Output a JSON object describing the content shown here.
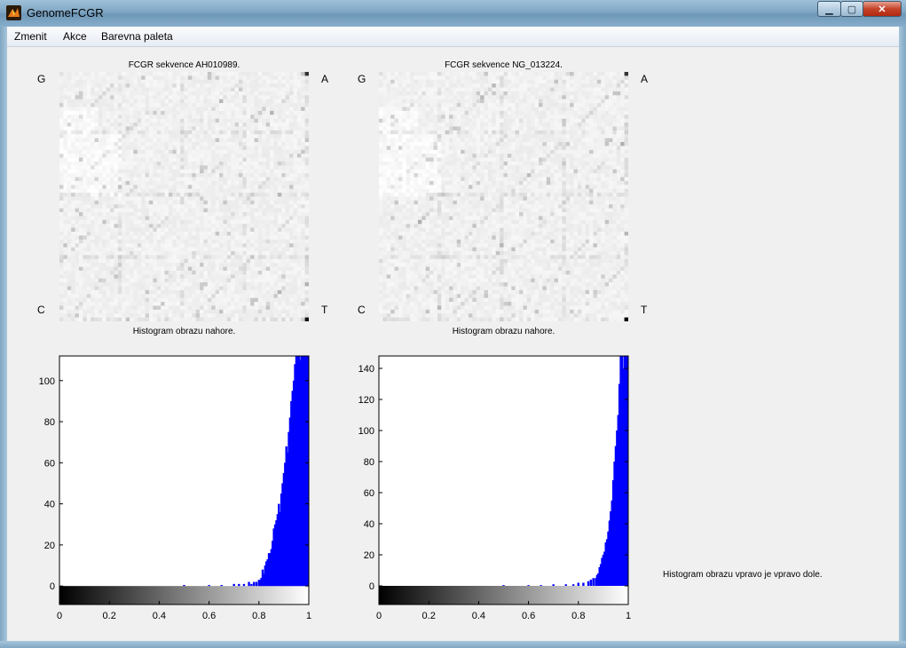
{
  "window": {
    "title": "GenomeFCGR",
    "min_glyph": "▁",
    "max_glyph": "▢",
    "close_glyph": "✕"
  },
  "menu": {
    "items": [
      "Zmenit",
      "Akce",
      "Barevna paleta"
    ]
  },
  "panels": [
    {
      "fcgr_title": "FCGR sekvence AH010989.",
      "corners": {
        "top_left": "G",
        "top_right": "A",
        "bottom_left": "C",
        "bottom_right": "T"
      }
    },
    {
      "fcgr_title": "FCGR sekvence NG_013224.",
      "corners": {
        "top_left": "G",
        "top_right": "A",
        "bottom_left": "C",
        "bottom_right": "T"
      }
    }
  ],
  "note": "Histogram obrazu vpravo je vpravo dole.",
  "colors": {
    "bar": "#0000ff",
    "colorbar_from": "#000000",
    "colorbar_to": "#ffffff"
  },
  "chart_data": [
    {
      "type": "bar",
      "title": "Histogram obrazu nahore.",
      "xlabel": "",
      "ylabel": "",
      "xlim": [
        0,
        1
      ],
      "ylim": [
        -9,
        112
      ],
      "xticks": [
        "0",
        "0.2",
        "0.4",
        "0.6",
        "0.8",
        "1"
      ],
      "yticks": [
        "0",
        "20",
        "40",
        "60",
        "80",
        "100"
      ],
      "grid": false,
      "x": [
        0.5,
        0.6,
        0.65,
        0.7,
        0.72,
        0.74,
        0.76,
        0.77,
        0.78,
        0.79,
        0.8,
        0.805,
        0.81,
        0.815,
        0.82,
        0.825,
        0.83,
        0.835,
        0.84,
        0.845,
        0.85,
        0.855,
        0.86,
        0.865,
        0.87,
        0.875,
        0.88,
        0.885,
        0.89,
        0.895,
        0.9,
        0.905,
        0.91,
        0.915,
        0.92,
        0.925,
        0.93,
        0.935,
        0.94,
        0.945,
        0.95,
        0.955,
        0.96,
        0.965,
        0.97,
        0.975,
        0.98,
        0.985,
        0.99,
        0.995
      ],
      "values": [
        0.5,
        0.5,
        0.5,
        1,
        1,
        1,
        2,
        1,
        2,
        2,
        3,
        3,
        4,
        8,
        6,
        10,
        12,
        13,
        16,
        16,
        18,
        22,
        28,
        30,
        32,
        35,
        40,
        36,
        45,
        50,
        55,
        60,
        68,
        65,
        75,
        82,
        90,
        95,
        100,
        108,
        112,
        112,
        112,
        110,
        112,
        112,
        112,
        112,
        112,
        112
      ]
    },
    {
      "type": "bar",
      "title": "Histogram obrazu nahore.",
      "xlabel": "",
      "ylabel": "",
      "xlim": [
        0,
        1
      ],
      "ylim": [
        -12,
        148
      ],
      "xticks": [
        "0",
        "0.2",
        "0.4",
        "0.6",
        "0.8",
        "1"
      ],
      "yticks": [
        "0",
        "20",
        "40",
        "60",
        "80",
        "100",
        "120",
        "140"
      ],
      "grid": false,
      "x": [
        0.5,
        0.6,
        0.65,
        0.7,
        0.75,
        0.78,
        0.8,
        0.82,
        0.84,
        0.85,
        0.86,
        0.87,
        0.875,
        0.88,
        0.885,
        0.89,
        0.895,
        0.9,
        0.905,
        0.91,
        0.915,
        0.92,
        0.925,
        0.93,
        0.935,
        0.94,
        0.945,
        0.95,
        0.955,
        0.96,
        0.965,
        0.97,
        0.975,
        0.98,
        0.985,
        0.99,
        0.995
      ],
      "values": [
        0.5,
        0.5,
        0.5,
        1,
        1,
        1,
        2,
        2,
        3,
        4,
        5,
        5,
        7,
        8,
        12,
        14,
        18,
        20,
        22,
        28,
        30,
        35,
        42,
        48,
        55,
        68,
        80,
        90,
        100,
        110,
        130,
        148,
        148,
        140,
        148,
        148,
        148
      ]
    }
  ]
}
